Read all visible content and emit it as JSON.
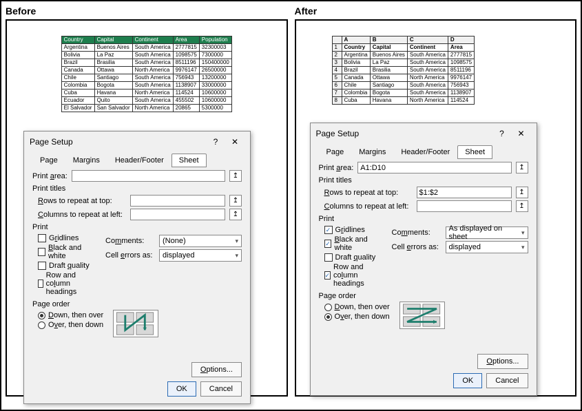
{
  "labels": {
    "before": "Before",
    "after": "After"
  },
  "table": {
    "headers": [
      "Country",
      "Capital",
      "Continent",
      "Area",
      "Population"
    ],
    "rows": [
      [
        "Argentina",
        "Buenos Aires",
        "South America",
        "2777815",
        "32300003"
      ],
      [
        "Bolivia",
        "La Paz",
        "South America",
        "1098575",
        "7300000"
      ],
      [
        "Brazil",
        "Brasilia",
        "South America",
        "8511196",
        "150400000"
      ],
      [
        "Canada",
        "Ottawa",
        "North America",
        "9976147",
        "26500000"
      ],
      [
        "Chile",
        "Santiago",
        "South America",
        "756943",
        "13200000"
      ],
      [
        "Colombia",
        "Bogota",
        "South America",
        "1138907",
        "33000000"
      ],
      [
        "Cuba",
        "Havana",
        "North America",
        "114524",
        "10600000"
      ],
      [
        "Ecuador",
        "Quito",
        "South America",
        "455502",
        "10600000"
      ],
      [
        "El Salvador",
        "San Salvador",
        "North America",
        "20865",
        "5300000"
      ]
    ]
  },
  "table_after": {
    "col_letters": [
      "A",
      "B",
      "C",
      "D"
    ],
    "rows": [
      [
        "Country",
        "Capital",
        "Continent",
        "Area"
      ],
      [
        "Argentina",
        "Buenos Aires",
        "South America",
        "2777815"
      ],
      [
        "Bolivia",
        "La Paz",
        "South America",
        "1098575"
      ],
      [
        "Brazil",
        "Brasilia",
        "South America",
        "8511196"
      ],
      [
        "Canada",
        "Ottawa",
        "North America",
        "9976147"
      ],
      [
        "Chile",
        "Santiago",
        "South America",
        "756943"
      ],
      [
        "Colombia",
        "Bogota",
        "South America",
        "1138907"
      ],
      [
        "Cuba",
        "Havana",
        "North America",
        "114524"
      ]
    ]
  },
  "dialog": {
    "title": "Page Setup",
    "help_glyph": "?",
    "close_glyph": "✕",
    "tabs": [
      "Page",
      "Margins",
      "Header/Footer",
      "Sheet"
    ],
    "print_area_label": "Print area:",
    "print_titles": "Print titles",
    "rows_repeat": "Rows to repeat at top:",
    "cols_repeat": "Columns to repeat at left:",
    "print_group": "Print",
    "gridlines": "Gridlines",
    "bw": "Black and white",
    "draft": "Draft quality",
    "rowcol": "Row and column headings",
    "comments": "Comments:",
    "cell_errors": "Cell errors as:",
    "page_order": "Page order",
    "down_over": "Down, then over",
    "over_down": "Over, then down",
    "options": "Options...",
    "ok": "OK",
    "cancel": "Cancel",
    "none": "(None)",
    "displayed": "displayed",
    "as_displayed": "As displayed on sheet"
  },
  "values": {
    "print_area_after": "A1:D10",
    "rows_repeat_after": "$1:$2"
  }
}
